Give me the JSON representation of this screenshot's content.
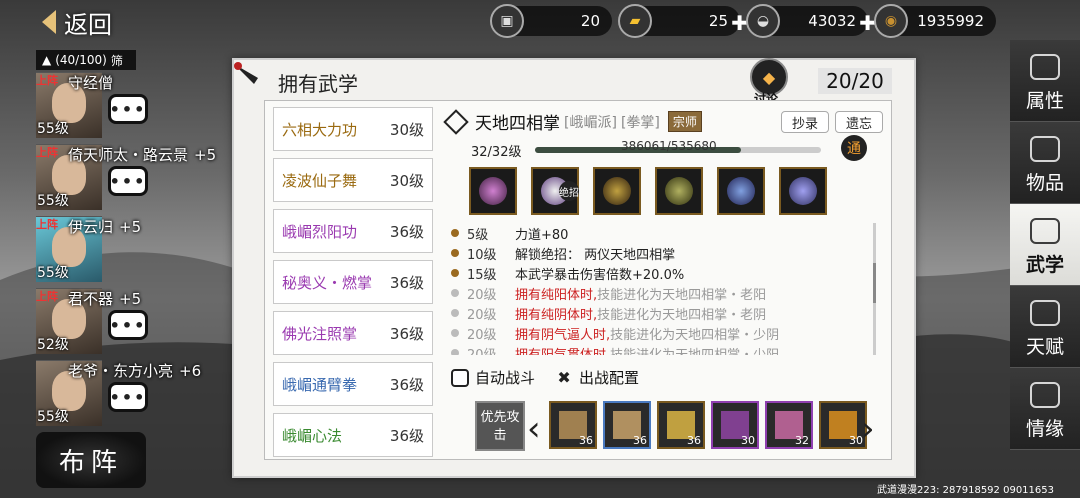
{
  "topbar": {
    "back_label": "返回",
    "currencies": [
      {
        "icon": "cart-icon",
        "value": "20",
        "has_plus": false
      },
      {
        "icon": "gold-bar-icon",
        "value": "25",
        "has_plus": true
      },
      {
        "icon": "silver-ingot-icon",
        "value": "43032",
        "has_plus": true
      },
      {
        "icon": "coin-icon",
        "value": "1935992",
        "has_plus": false
      }
    ]
  },
  "roster": {
    "team_count": "(40/100)",
    "filter_label": "筛",
    "onstage_label": "上阵",
    "heroes": [
      {
        "name": "守经僧",
        "bonus": "",
        "level": "55级"
      },
      {
        "name": "倚天师太・路云景",
        "bonus": "+5",
        "level": "55级"
      },
      {
        "name": "伊云归",
        "bonus": "+5",
        "level": "55级"
      },
      {
        "name": "君不器",
        "bonus": "+5",
        "level": "52级"
      },
      {
        "name": "老爷・东方小亮",
        "bonus": "+6",
        "level": "55级"
      }
    ],
    "formation_label": "布阵"
  },
  "panel": {
    "title": "拥有武学",
    "discuss_label": "讨论",
    "count": "20/20"
  },
  "skills": [
    {
      "name": "六相大力功",
      "level": "30级",
      "color": "#9a6a10"
    },
    {
      "name": "凌波仙子舞",
      "level": "30级",
      "color": "#9a6a10"
    },
    {
      "name": "峨嵋烈阳功",
      "level": "36级",
      "color": "#9a3ab0"
    },
    {
      "name": "秘奥义・燃掌",
      "level": "36级",
      "color": "#9a3ab0"
    },
    {
      "name": "佛光注照掌",
      "level": "36级",
      "color": "#9a3ab0"
    },
    {
      "name": "峨嵋通臂拳",
      "level": "36级",
      "color": "#3a6ab0"
    },
    {
      "name": "峨嵋心法",
      "level": "36级",
      "color": "#3a8a30"
    }
  ],
  "detail": {
    "name": "天地四相掌",
    "sect": "[峨嵋派]",
    "type": "[拳掌]",
    "rank": "宗师",
    "copy_label": "抄录",
    "legacy_label": "遗忘",
    "level": "32/32级",
    "exp": "386061/535680",
    "exp_ratio": 0.72,
    "tong_label": "通",
    "ultimate_tag": "绝招",
    "effects": [
      {
        "lv": "5级",
        "text": "力道+80",
        "red": "",
        "gray": "",
        "locked": false
      },
      {
        "lv": "10级",
        "text": "解锁绝招：  两仪天地四相掌",
        "red": "",
        "gray": "",
        "locked": false
      },
      {
        "lv": "15级",
        "text": "本武学暴击伤害倍数+20.0%",
        "red": "",
        "gray": "",
        "locked": false
      },
      {
        "lv": "20级",
        "text": "",
        "red": "拥有纯阳体时,",
        "gray": "技能进化为天地四相掌・老阳",
        "locked": true
      },
      {
        "lv": "20级",
        "text": "",
        "red": "拥有纯阴体时,",
        "gray": "技能进化为天地四相掌・老阴",
        "locked": true
      },
      {
        "lv": "20级",
        "text": "",
        "red": "拥有阴气逼人时,",
        "gray": "技能进化为天地四相掌・少阴",
        "locked": true
      },
      {
        "lv": "20级",
        "text": "",
        "red": "拥有阳气贯体时,",
        "gray": "技能进化为天地四相掌・少阳",
        "locked": true
      }
    ],
    "auto_battle_label": "自动战斗",
    "battle_config_label": "出战配置",
    "priority_label": "优先攻击",
    "equips": [
      {
        "level": "36"
      },
      {
        "level": "36"
      },
      {
        "level": "36"
      },
      {
        "level": "30"
      },
      {
        "level": "32"
      },
      {
        "level": "30"
      }
    ]
  },
  "tabs": [
    "属性",
    "物品",
    "武学",
    "天赋",
    "情缘"
  ],
  "footer": "武道漫漫223: 287918592 09011653"
}
